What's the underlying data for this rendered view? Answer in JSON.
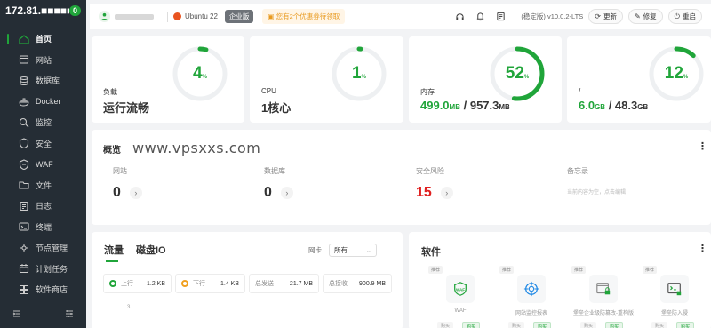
{
  "sidebar": {
    "server_ip": "172.81.■■■■■■",
    "badge": "0",
    "items": [
      {
        "label": "首页",
        "icon": "home-icon",
        "active": true
      },
      {
        "label": "网站",
        "icon": "globe-icon"
      },
      {
        "label": "数据库",
        "icon": "database-icon"
      },
      {
        "label": "Docker",
        "icon": "docker-icon"
      },
      {
        "label": "监控",
        "icon": "monitor-icon"
      },
      {
        "label": "安全",
        "icon": "shield-icon"
      },
      {
        "label": "WAF",
        "icon": "firewall-icon"
      },
      {
        "label": "文件",
        "icon": "folder-icon"
      },
      {
        "label": "日志",
        "icon": "log-icon"
      },
      {
        "label": "终端",
        "icon": "terminal-icon"
      },
      {
        "label": "节点管理",
        "icon": "nodes-icon"
      },
      {
        "label": "计划任务",
        "icon": "calendar-icon"
      },
      {
        "label": "软件商店",
        "icon": "store-icon"
      }
    ]
  },
  "topbar": {
    "os": "Ubuntu 22",
    "edition": "企业版",
    "promo": "您有2个优惠券待领取",
    "version": "(稳定版) v10.0.2-LTS",
    "update_label": "更新",
    "repair_label": "修复",
    "restart_label": "重启"
  },
  "status_cards": [
    {
      "label": "负载",
      "value": "运行流畅",
      "percent": 4
    },
    {
      "label": "CPU",
      "value": "1核心",
      "percent": 1
    },
    {
      "label": "内存",
      "used": "499.0",
      "used_unit": "MB",
      "sep": " / ",
      "total": "957.3",
      "total_unit": "MB",
      "percent": 52
    },
    {
      "label": "/",
      "used": "6.0",
      "used_unit": "GB",
      "sep": " / ",
      "total": "48.3",
      "total_unit": "GB",
      "percent": 12
    }
  ],
  "overview": {
    "title": "概览",
    "watermark": "www.vpsxxs.com",
    "items": [
      {
        "label": "网站",
        "value": "0"
      },
      {
        "label": "数据库",
        "value": "0"
      },
      {
        "label": "安全风险",
        "value": "15"
      },
      {
        "label": "备忘录",
        "text": "当前内容为空，点击编辑"
      }
    ]
  },
  "traffic": {
    "tabs": [
      "流量",
      "磁盘IO"
    ],
    "nic_label": "网卡",
    "nic_value": "所有",
    "stats": [
      {
        "label": "上行",
        "value": "1.2 KB"
      },
      {
        "label": "下行",
        "value": "1.4 KB"
      },
      {
        "label": "总发送",
        "value": "21.7 MB"
      },
      {
        "label": "总接收",
        "value": "900.9 MB"
      }
    ],
    "y_tick": "3"
  },
  "software": {
    "title": "软件",
    "items": [
      {
        "tag": "推荐",
        "name": "WAF",
        "b1": "购买",
        "b2": "购买"
      },
      {
        "tag": "推荐",
        "name": "网站监控报表",
        "b1": "购买",
        "b2": "购买"
      },
      {
        "tag": "推荐",
        "name": "堡垒企业级防篡改-重构版",
        "b1": "购买",
        "b2": "购买"
      },
      {
        "tag": "推荐",
        "name": "堡垒防入侵",
        "b1": "购买",
        "b2": "购买"
      }
    ]
  },
  "colors": {
    "accent": "#20a53a",
    "sidebar_bg": "#252d35",
    "danger": "#e02020"
  }
}
